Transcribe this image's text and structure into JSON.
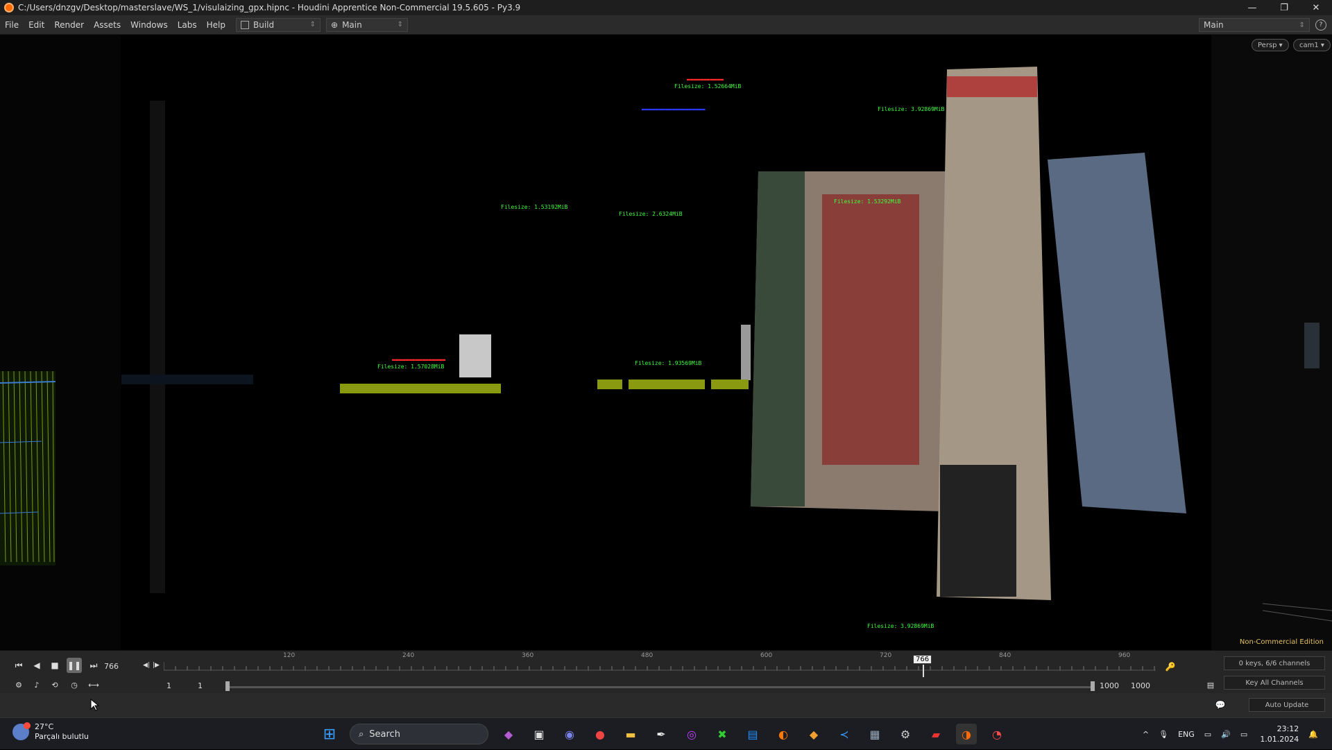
{
  "window": {
    "title": "C:/Users/dnzgv/Desktop/masterslave/WS_1/visulaizing_gpx.hipnc - Houdini Apprentice Non-Commercial 19.5.605 - Py3.9",
    "minimize": "—",
    "maximize": "❐",
    "close": "✕"
  },
  "menubar": {
    "items": [
      "File",
      "Edit",
      "Render",
      "Assets",
      "Windows",
      "Labs",
      "Help"
    ],
    "desktop": "Build",
    "network": "Main",
    "desktop_right": "Main"
  },
  "viewport": {
    "persp": "Persp ▾",
    "cam": "cam1 ▾",
    "non_commercial": "Non-Commercial Edition",
    "labels": {
      "top_center": "Filesize: 1.52664MiB",
      "top_right": "Filesize: 3.92869MiB",
      "mid_left": "Filesize: 1.53192MiB",
      "mid_center": "Filesize: 2.6324MiB",
      "mid_right": "Filesize: 1.53292MiB",
      "left_cluster": "Filesize: 1.57028MiB",
      "center_cluster": "Filesize: 1.93569MiB",
      "bottom_right": "Filesize: 3.92869MiB"
    }
  },
  "timeline": {
    "current_frame": "766",
    "cursor_label": "766",
    "ticks": [
      "120",
      "240",
      "360",
      "480",
      "600",
      "720",
      "840",
      "960"
    ],
    "range_start": "1",
    "range_start2": "1",
    "range_end": "1000",
    "range_end2": "1000",
    "keys_info": "0 keys, 6/6 channels",
    "key_all": "Key All Channels",
    "auto_update": "Auto Update"
  },
  "taskbar": {
    "temp": "27°C",
    "weather": "Parçalı bulutlu",
    "search": "Search",
    "lang": "ENG",
    "time": "23:12",
    "date": "1.01.2024"
  }
}
